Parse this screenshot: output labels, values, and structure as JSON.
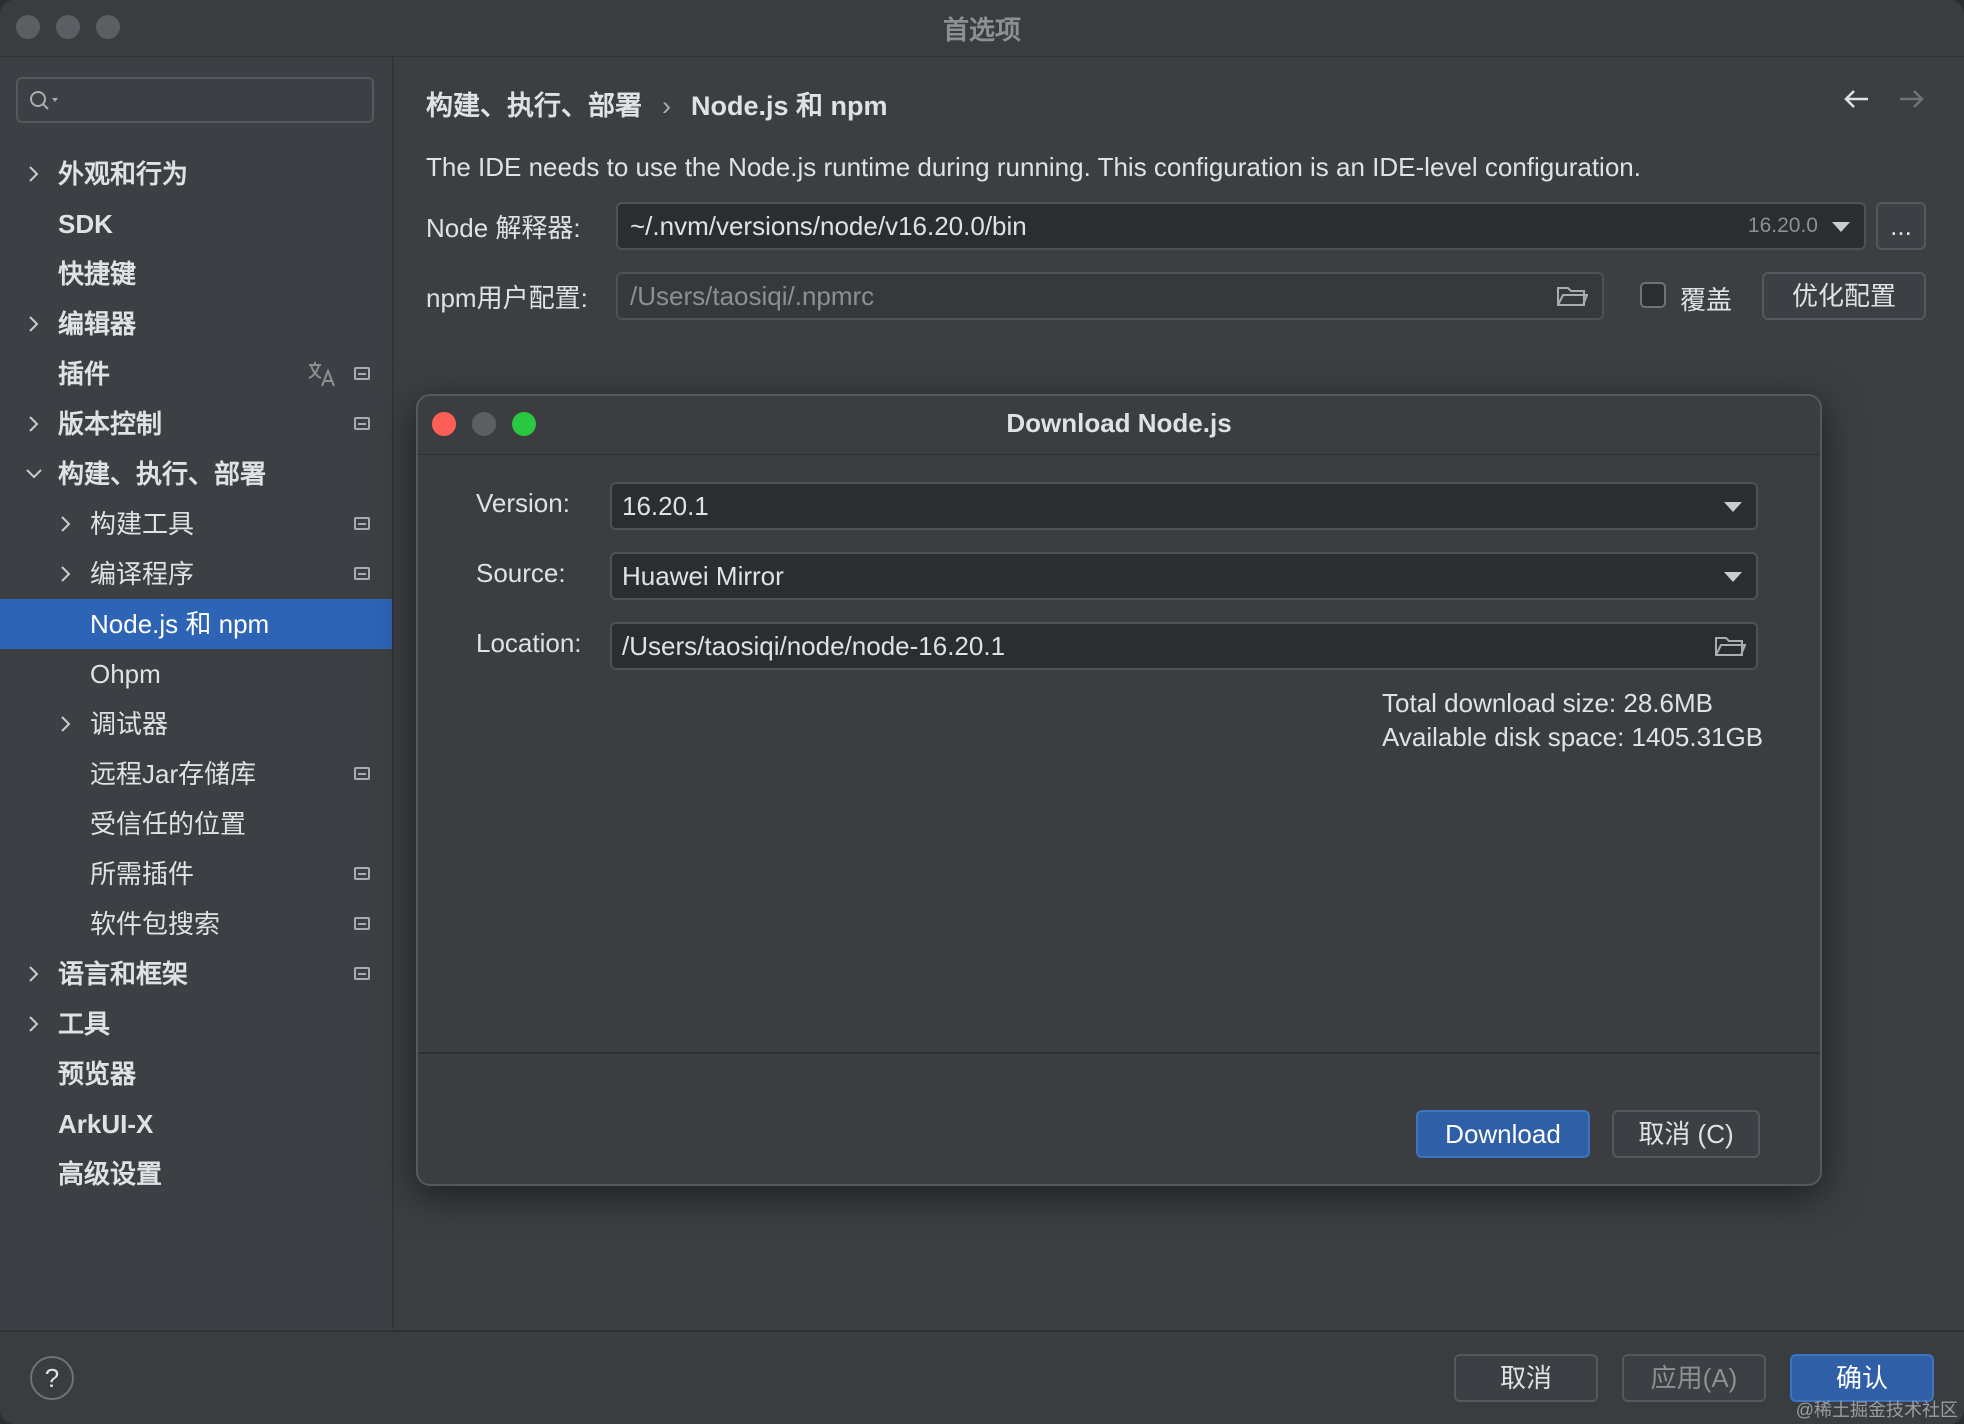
{
  "window": {
    "title": "首选项"
  },
  "sidebar": {
    "search_placeholder": "",
    "items": [
      {
        "label": "外观和行为",
        "expandable": true
      },
      {
        "label": "SDK"
      },
      {
        "label": "快捷键"
      },
      {
        "label": "编辑器",
        "expandable": true
      },
      {
        "label": "插件",
        "icons": [
          "translate-icon",
          "module-icon"
        ]
      },
      {
        "label": "版本控制",
        "expandable": true,
        "icons": [
          "module-icon"
        ]
      },
      {
        "label": "构建、执行、部署",
        "expanded": true
      },
      {
        "label": "构建工具",
        "expandable": true,
        "icons": [
          "module-icon"
        ]
      },
      {
        "label": "编译程序",
        "expandable": true,
        "icons": [
          "module-icon"
        ]
      },
      {
        "label": "Node.js 和 npm",
        "selected": true
      },
      {
        "label": "Ohpm"
      },
      {
        "label": "调试器",
        "expandable": true
      },
      {
        "label": "远程Jar存储库",
        "icons": [
          "module-icon"
        ]
      },
      {
        "label": "受信任的位置"
      },
      {
        "label": "所需插件",
        "icons": [
          "module-icon"
        ]
      },
      {
        "label": "软件包搜索",
        "icons": [
          "module-icon"
        ]
      },
      {
        "label": "语言和框架",
        "expandable": true,
        "icons": [
          "module-icon"
        ]
      },
      {
        "label": "工具",
        "expandable": true
      },
      {
        "label": "预览器"
      },
      {
        "label": "ArkUI-X"
      },
      {
        "label": "高级设置"
      }
    ]
  },
  "content": {
    "breadcrumb": [
      "构建、执行、部署",
      "Node.js 和 npm"
    ],
    "breadcrumb_sep": "›",
    "description": "The IDE needs to use the Node.js runtime during running. This configuration is an IDE-level configuration.",
    "node_interpreter": {
      "label": "Node 解释器:",
      "value": "~/.nvm/versions/node/v16.20.0/bin",
      "version": "16.20.0",
      "more_button": "..."
    },
    "npm_config": {
      "label": "npm用户配置:",
      "value": "/Users/taosiqi/.npmrc",
      "override_label": "覆盖",
      "override_checked": false,
      "optimize_button": "优化配置"
    }
  },
  "dialog": {
    "title": "Download Node.js",
    "version_label": "Version:",
    "version_value": "16.20.1",
    "source_label": "Source:",
    "source_value": "Huawei Mirror",
    "location_label": "Location:",
    "location_value": "/Users/taosiqi/node/node-16.20.1",
    "total_size": "Total download size: 28.6MB",
    "disk_space": "Available disk space: 1405.31GB",
    "download_button": "Download",
    "cancel_button": "取消 (C)",
    "traffic_colors": {
      "close": "#ff5f57",
      "minimize": "#5b5e62",
      "zoom": "#28c840"
    }
  },
  "footer": {
    "help": "?",
    "cancel": "取消",
    "apply": "应用(A)",
    "ok": "确认",
    "watermark": "@稀土掘金技术社区"
  },
  "colors": {
    "accent": "#2e64b6",
    "primary_button": "#2f5fa6"
  }
}
